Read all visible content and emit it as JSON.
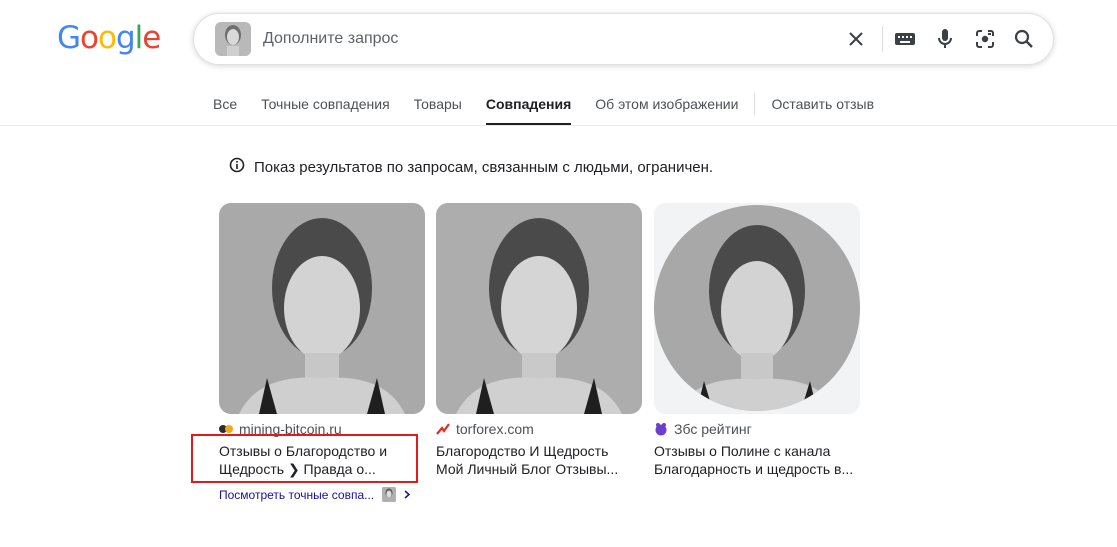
{
  "logo": {
    "letters": [
      "G",
      "o",
      "o",
      "g",
      "l",
      "e"
    ],
    "colors": [
      "#4285f4",
      "#ea4335",
      "#fbbc05",
      "#4285f4",
      "#34a853",
      "#ea4335"
    ]
  },
  "search": {
    "placeholder": "Дополните запрос",
    "icons": [
      "image-thumbnail",
      "close-icon",
      "keyboard-icon",
      "mic-icon",
      "lens-icon",
      "search-icon"
    ]
  },
  "tabs": [
    {
      "label": "Все"
    },
    {
      "label": "Точные совпадения"
    },
    {
      "label": "Товары"
    },
    {
      "label": "Совпадения",
      "active": true
    },
    {
      "label": "Об этом изображении"
    },
    {
      "label": "Оставить отзыв"
    }
  ],
  "notice": {
    "text": "Показ результатов по запросам, связанным с людьми, ограничен."
  },
  "results": [
    {
      "source": "mining-bitcoin.ru",
      "title_line1": "Отзывы о Благородство и",
      "title_line2": "Щедрость ❯ Правда о...",
      "favicon": "mb-favicon"
    },
    {
      "source": "torforex.com",
      "title_line1": "Благородство И Щедрость",
      "title_line2": "Мой Личный Блог Отзывы...",
      "favicon": "torforex-favicon"
    },
    {
      "source": "Збс рейтинг",
      "title_line1": "Отзывы о Полине с канала",
      "title_line2": "Благодарность и щедрость в...",
      "favicon": "zbs-favicon"
    }
  ],
  "exact_link": {
    "label": "Посмотреть точные совпа..."
  },
  "colors": {
    "accent_link": "#1a0dab",
    "highlight_border": "#e01b1b"
  }
}
